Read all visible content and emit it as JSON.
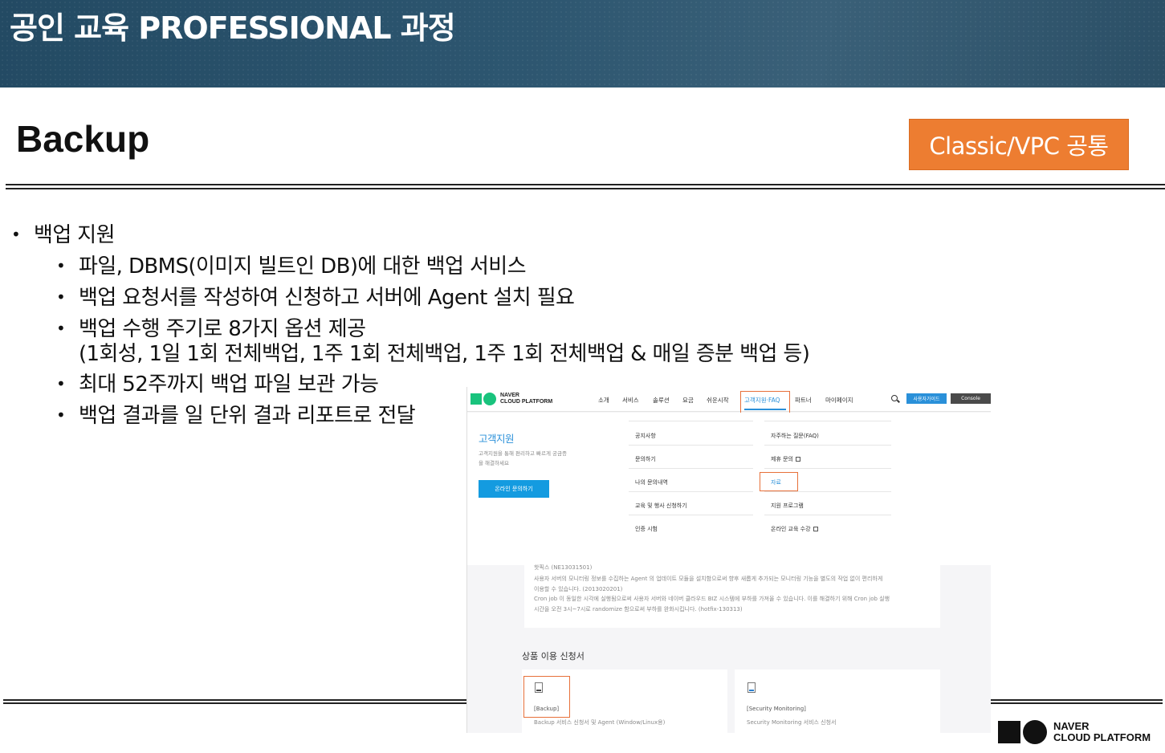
{
  "banner": {
    "course_title": "공인 교육 PROFESSIONAL 과정"
  },
  "slide": {
    "title": "Backup",
    "scope_badge": "Classic/VPC 공통"
  },
  "bullets": {
    "main": "백업 지원",
    "sub": [
      "파일, DBMS(이미지 빌트인 DB)에 대한 백업 서비스",
      "백업 요청서를 작성하여 신청하고 서버에 Agent 설치 필요",
      "백업 수행 주기로 8가지 옵션 제공",
      "(1회성, 1일 1회 전체백업, 1주 1회 전체백업, 1주 1회 전체백업 & 매일 증분 백업 등)",
      "최대 52주까지 백업 파일 보관 가능",
      "백업 결과를 일 단위 결과 리포트로 전달"
    ]
  },
  "footer_logo": {
    "line1": "NAVER",
    "line2": "CLOUD PLATFORM"
  },
  "screenshot": {
    "brand": {
      "line1": "NAVER",
      "line2": "CLOUD PLATFORM"
    },
    "menu": [
      "소개",
      "서비스",
      "솔루션",
      "요금",
      "쉬운시작",
      "고객지원·FAQ",
      "파트너",
      "마이페이지"
    ],
    "btn_guide": "사용자가이드",
    "btn_console": "Console",
    "support_title": "고객지원",
    "support_desc": "고객지원을 통해 편리하고 빠르게 궁금증을 해결하세요",
    "support_button": "온라인 문의하기",
    "links_left": [
      "공지사항",
      "문의하기",
      "나의 문의내역",
      "교육 및 행사 신청하기",
      "인증 시험"
    ],
    "links_right": [
      "자주하는 질문(FAQ)",
      "제휴 문의",
      "자료",
      "지원 프로그램",
      "온라인 교육 수강"
    ],
    "notice_lines": [
      "핫픽스 (NE13031501)",
      "사용자 서버의 모니터링 정보를 수집하는 Agent 의 업데이트 모듈을 설치함으로써 향후 새롭게 추가되는 모니터링 기능을 별도의 작업 없이 편리하게",
      "이용할 수 있습니다. (2013020201)",
      "Cron job 이 동일한 시각에 실행됨으로써 사용자 서버와 네이버 클라우드 BIZ 시스템에 부하를 가져올 수 있습니다. 이를 해결하기 위해 Cron job 실행",
      "시간을 오전 3시~7시로 randomize 함으로써 부하를 완화시킵니다. (hotfix-130313)"
    ],
    "forms_title": "상품 이용 신청서",
    "cards": [
      {
        "name": "[Backup]",
        "desc": "Backup 서비스 신청서 및 Agent (Window/Linux용)"
      },
      {
        "name": "[Security Monitoring]",
        "desc": "Security Monitoring 서비스 신청서"
      }
    ]
  }
}
